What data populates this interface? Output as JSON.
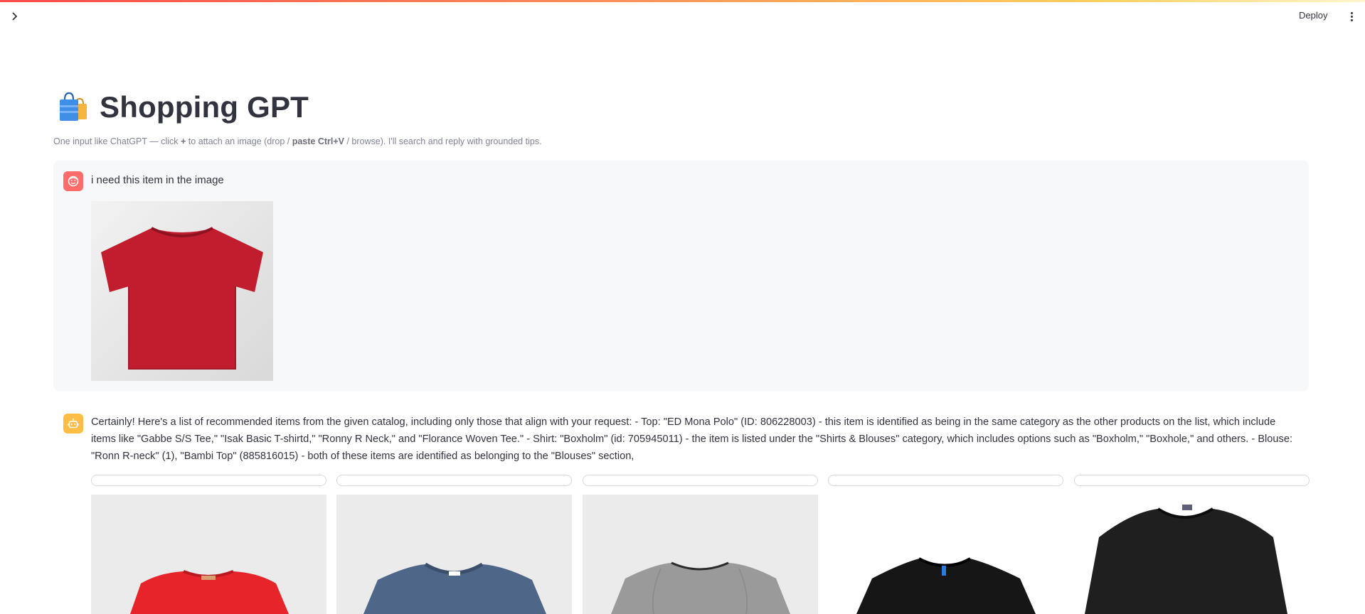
{
  "header": {
    "deploy_label": "Deploy",
    "sidebar_toggle_icon": "chevron-right-icon",
    "menu_icon": "vertical-dots-icon"
  },
  "page": {
    "icon": "shopping-bags-icon",
    "title": "Shopping GPT",
    "subtitle": {
      "part1": "One input like ChatGPT — click ",
      "plus": "+",
      "part2": " to attach an image (drop / ",
      "paste": "paste Ctrl+V",
      "part3": " / browse). I'll search and reply with grounded tips."
    }
  },
  "chat": {
    "user_message": {
      "avatar_icon": "user-face-icon",
      "text": "i need this item in the image",
      "image_icon": "red-tshirt-image"
    },
    "assistant_message": {
      "avatar_icon": "robot-icon",
      "text": "Certainly! Here's a list of recommended items from the given catalog, including only those that align with your request: - Top: \"ED Mona Polo\" (ID: 806228003) - this item is identified as being in the same category as the other products on the list, which include items like \"Gabbe S/S Tee,\" \"Isak Basic T-shirtd,\" \"Ronny R Neck,\" and \"Florance Woven Tee.\" - Shirt: \"Boxholm\" (id: 705945011) - the item is listed under the \"Shirts & Blouses\" category, which includes options such as \"Boxholm,\" \"Boxhole,\" and others. - Blouse: \"Ronn R-neck\" (1), \"Bambi Top\" (885816015) - both of these items are identified as belonging to the \"Blouses\" section,"
    },
    "products": [
      {
        "image_icon": "red-ribbed-top-image",
        "color": "#e8242b"
      },
      {
        "image_icon": "blue-tshirt-image",
        "color": "#4e6688"
      },
      {
        "image_icon": "grey-tshirt-image",
        "color": "#9a9a9a"
      },
      {
        "image_icon": "black-tshirt-image",
        "color": "#161616"
      },
      {
        "image_icon": "black-top-image",
        "color": "#1f1f1f"
      }
    ]
  },
  "colors": {
    "accent_gradient": [
      "#ff4b4b",
      "#fdcf5b"
    ],
    "user_avatar": "#ff6c6c",
    "bot_avatar": "#ffbd45",
    "message_bg": "#f7f8fa"
  }
}
